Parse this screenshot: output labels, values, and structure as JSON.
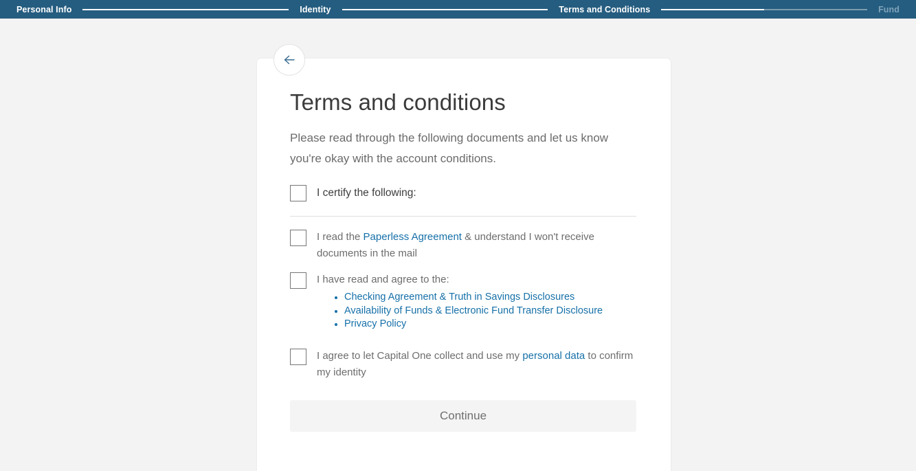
{
  "colors": {
    "nav_background": "#255d80",
    "nav_active_text": "#ffffff",
    "nav_inactive_text": "#7fa3b9",
    "page_background": "#f3f3f3",
    "card_background": "#ffffff",
    "link": "#1670a8",
    "body_text": "#6d6d6d",
    "title_text": "#3b3b3b",
    "button_disabled_bg": "#f4f4f4",
    "button_disabled_text": "#6f6f6f",
    "checkbox_border": "#767676"
  },
  "progress_nav": {
    "steps": [
      {
        "label": "Personal Info",
        "state": "complete"
      },
      {
        "label": "Identity",
        "state": "complete"
      },
      {
        "label": "Terms and Conditions",
        "state": "current"
      },
      {
        "label": "Fund",
        "state": "upcoming"
      }
    ]
  },
  "back_button": {
    "icon": "arrow-left-icon",
    "label": "Back"
  },
  "main": {
    "title": "Terms and conditions",
    "intro": "Please read through the following documents and let us know you're okay with the account conditions.",
    "certify": {
      "label": "I certify the following:",
      "checked": false
    },
    "agreements": [
      {
        "id": "paperless",
        "checked": false,
        "text_before": "I read the ",
        "link": "Paperless Agreement",
        "text_after": " & understand I won't receive documents in the mail"
      },
      {
        "id": "disclosures",
        "checked": false,
        "text_before": "I have read and agree to the:",
        "links": [
          "Checking Agreement & Truth in Savings Disclosures",
          "Availability of Funds & Electronic Fund Transfer Disclosure",
          "Privacy Policy"
        ]
      },
      {
        "id": "personal-data",
        "checked": false,
        "text_before": "I agree to let Capital One collect and use my ",
        "link": "personal data",
        "text_after": " to confirm my identity"
      }
    ],
    "continue_button": {
      "label": "Continue",
      "enabled": false
    }
  }
}
